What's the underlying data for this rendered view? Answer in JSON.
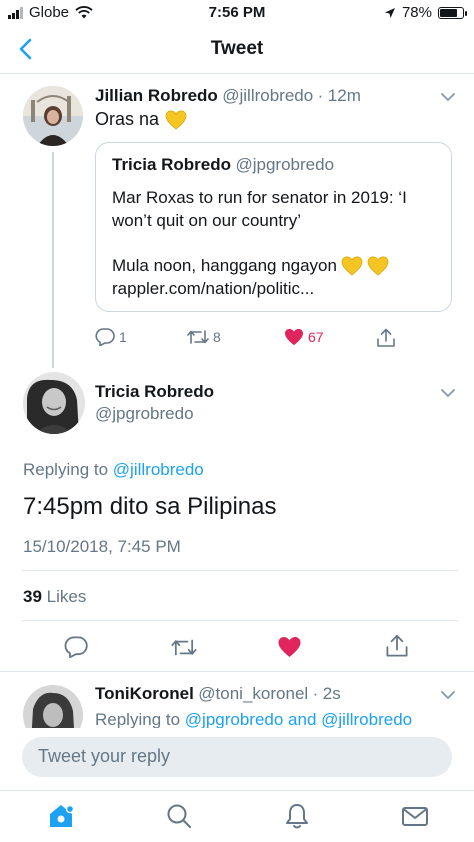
{
  "status_bar": {
    "carrier": "Globe",
    "time": "7:56 PM",
    "battery": "78%",
    "battery_level": 0.78,
    "icons": [
      "signal-icon",
      "wifi-icon",
      "location-arrow-icon",
      "battery-icon"
    ]
  },
  "nav": {
    "title": "Tweet",
    "back_icon": "chevron-left-icon"
  },
  "parent_tweet": {
    "name": "Jillian Robredo",
    "handle": "@jillrobredo",
    "separator": "·",
    "time": "12m",
    "text": "Oras na",
    "emoji": "yellow-heart",
    "quote": {
      "name": "Tricia Robredo",
      "handle": "@jpgrobredo",
      "line1": "Mar Roxas to run for senator in 2019: ‘I",
      "line2": "won’t quit on our country’",
      "line3": "Mula noon, hanggang ngayon",
      "line4": "rappler.com/nation/politic..."
    },
    "actions": {
      "replies": "1",
      "retweets": "8",
      "likes": "67"
    },
    "colors": {
      "like": "#e0245e",
      "link": "#1da1f2"
    }
  },
  "main_tweet": {
    "name": "Tricia Robredo",
    "handle": "@jpgrobredo",
    "replying_prefix": "Replying to",
    "replying_to": "@jillrobredo",
    "text": "7:45pm dito sa Pilipinas",
    "timestamp": "15/10/2018, 7:45 PM",
    "likes_count": "39",
    "likes_label": "Likes"
  },
  "reply_tweet": {
    "name": "ToniKoronel",
    "handle": "@toni_koronel",
    "separator": "·",
    "time": "2s",
    "replying_prefix": "Replying to",
    "replying_to": "@jpgrobredo and @jillrobredo"
  },
  "composer": {
    "placeholder": "Tweet your reply"
  },
  "tabbar": {
    "tabs": [
      "home-icon",
      "search-icon",
      "notifications-icon",
      "messages-icon"
    ],
    "active": "home-icon",
    "accent": "#1da1f2"
  }
}
